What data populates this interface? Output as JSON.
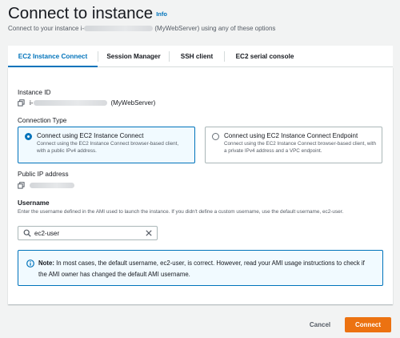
{
  "header": {
    "title": "Connect to instance",
    "info_link": "Info",
    "subtitle_prefix": "Connect to your instance i-",
    "subtitle_suffix": " (MyWebServer) using any of these options"
  },
  "tabs": [
    {
      "label": "EC2 Instance Connect",
      "active": true
    },
    {
      "label": "Session Manager",
      "active": false
    },
    {
      "label": "SSH client",
      "active": false
    },
    {
      "label": "EC2 serial console",
      "active": false
    }
  ],
  "instance": {
    "label": "Instance ID",
    "id_prefix": "i-",
    "name": "(MyWebServer)"
  },
  "connection_type": {
    "label": "Connection Type",
    "options": [
      {
        "title": "Connect using EC2 Instance Connect",
        "description": "Connect using the EC2 Instance Connect browser-based client, with a public IPv4 address.",
        "selected": true
      },
      {
        "title": "Connect using EC2 Instance Connect Endpoint",
        "description": "Connect using the EC2 Instance Connect browser-based client, with a private IPv4 address and a VPC endpoint.",
        "selected": false
      }
    ]
  },
  "public_ip": {
    "label": "Public IP address"
  },
  "username": {
    "label": "Username",
    "description": "Enter the username defined in the AMI used to launch the instance. If you didn't define a custom username, use the default username, ec2-user.",
    "value": "ec2-user"
  },
  "alert": {
    "prefix": "Note:",
    "text": " In most cases, the default username, ec2-user, is correct. However, read your AMI usage instructions to check if the AMI owner has changed the default AMI username."
  },
  "footer": {
    "cancel_label": "Cancel",
    "connect_label": "Connect"
  },
  "colors": {
    "accent": "#0073bb",
    "primary_button": "#ec7211",
    "background": "#f2f3f3"
  }
}
